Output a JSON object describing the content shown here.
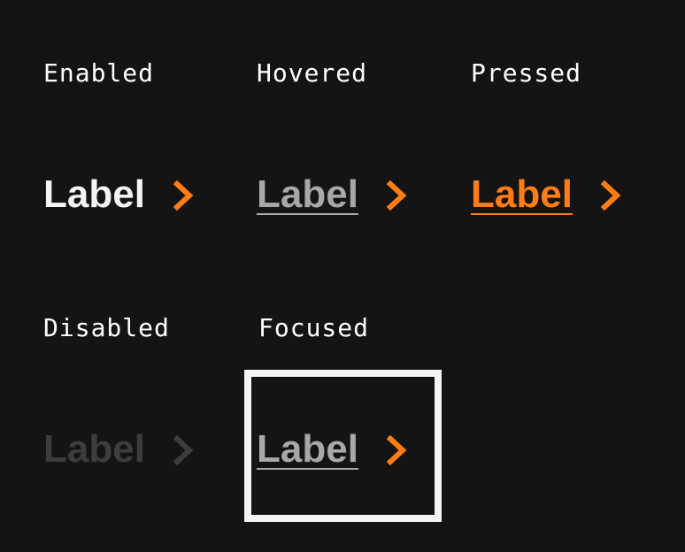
{
  "colors": {
    "background": "#141414",
    "text_enabled": "#f4f4f4",
    "text_hovered": "#a8a8a8",
    "accent": "#ff7d14",
    "text_disabled": "#3d3d3d",
    "focus_ring": "#f4f4f4"
  },
  "states": {
    "enabled": {
      "title": "Enabled",
      "label": "Label",
      "icon": "chevron-right-icon"
    },
    "hovered": {
      "title": "Hovered",
      "label": "Label",
      "icon": "chevron-right-icon"
    },
    "pressed": {
      "title": "Pressed",
      "label": "Label",
      "icon": "chevron-right-icon"
    },
    "disabled": {
      "title": "Disabled",
      "label": "Label",
      "icon": "chevron-right-icon"
    },
    "focused": {
      "title": "Focused",
      "label": "Label",
      "icon": "chevron-right-icon"
    }
  }
}
